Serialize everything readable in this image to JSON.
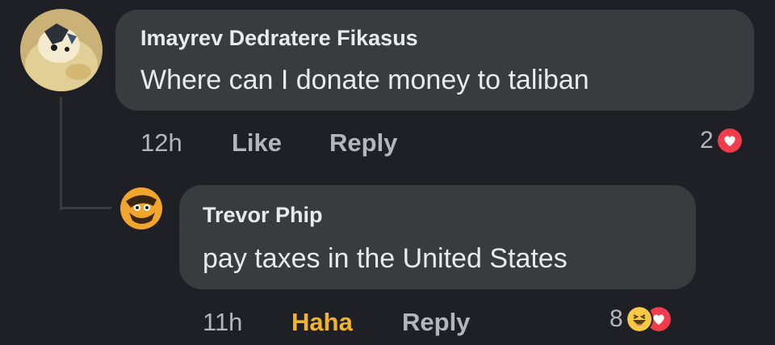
{
  "colors": {
    "background": "#1f2026",
    "bubble": "#3a3b3f",
    "text_primary": "#e9eaee",
    "text_secondary": "#b4b6bc",
    "haha_active": "#f2b52a",
    "love_red": "#f03c4c",
    "haha_yellow": "#f7c944"
  },
  "comments": [
    {
      "author": "Imayrev Dedratere Fikasus",
      "text": "Where can I donate money to taliban",
      "time": "12h",
      "like_label": "Like",
      "reply_label": "Reply",
      "reaction_count": "2",
      "reaction_icons": [
        "love-icon"
      ]
    },
    {
      "author": "Trevor Phip",
      "text": "pay taxes in the United States",
      "time": "11h",
      "like_label": "Haha",
      "reply_label": "Reply",
      "reaction_count": "8",
      "reaction_icons": [
        "haha-icon",
        "love-icon"
      ]
    }
  ]
}
